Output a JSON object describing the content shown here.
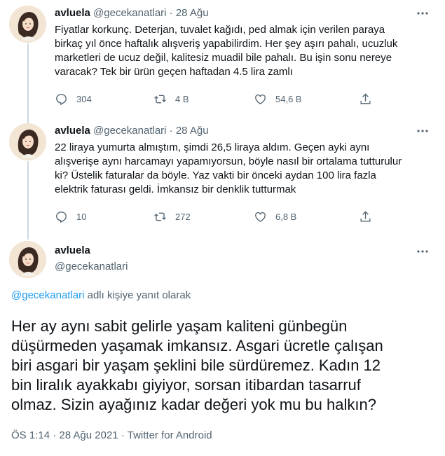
{
  "tweets": [
    {
      "display_name": "avluela",
      "handle": "@gecekanatlari",
      "separator": "·",
      "date": "28 Ağu",
      "text": "Fiyatlar korkunç. Deterjan, tuvalet kağıdı, ped almak için verilen paraya\nbirkaç yıl önce haftalık alışveriş yapabilirdim. Her şey aşırı pahalı, ucuzluk\nmarketleri de ucuz değil, kalitesiz muadil bile pahalı. Bu işin sonu nereye\nvaracak? Tek bir ürün geçen haftadan 4.5 lira zamlı",
      "replies": "304",
      "retweets": "4 B",
      "likes": "54,6 B"
    },
    {
      "display_name": "avluela",
      "handle": "@gecekanatlari",
      "separator": "·",
      "date": "28 Ağu",
      "text": "22 liraya yumurta almıştım, şimdi 26,5 liraya aldım. Geçen ayki aynı\nalışverişe aynı harcamayı yapamıyorsun, böyle nasıl bir ortalama tutturulur\nki? Üstelik faturalar da böyle. Yaz vakti bir önceki aydan 100 lira fazla\nelektrik faturası geldi. İmkansız bir denklik tutturmak",
      "replies": "10",
      "retweets": "272",
      "likes": "6,8 B"
    }
  ],
  "main_tweet": {
    "display_name": "avluela",
    "handle": "@gecekanatlari",
    "reply_to_handle": "@gecekanatlari",
    "reply_to_suffix": " adlı kişiye yanıt olarak",
    "text": "Her ay aynı sabit gelirle yaşam kaliteni günbegün\ndüşürmeden yaşamak imkansız. Asgari ücretle çalışan\nbiri asgari bir yaşam şeklini bile sürdüremez. Kadın 12\nbin liralık ayakkabı giyiyor, sorsan itibardan tasarruf\nolmaz. Sizin ayağınız kadar değeri yok mu bu halkın?",
    "time": "ÖS 1:14",
    "date": "28 Ağu 2021",
    "separator": "·",
    "source": "Twitter for Android"
  },
  "icons": {
    "reply": "reply-icon",
    "retweet": "retweet-icon",
    "like": "like-icon",
    "share": "share-icon",
    "more": "more-icon"
  },
  "colors": {
    "text": "#0f1419",
    "muted": "#536471",
    "link": "#1d9bf0",
    "thread_line": "#cfd9de"
  }
}
